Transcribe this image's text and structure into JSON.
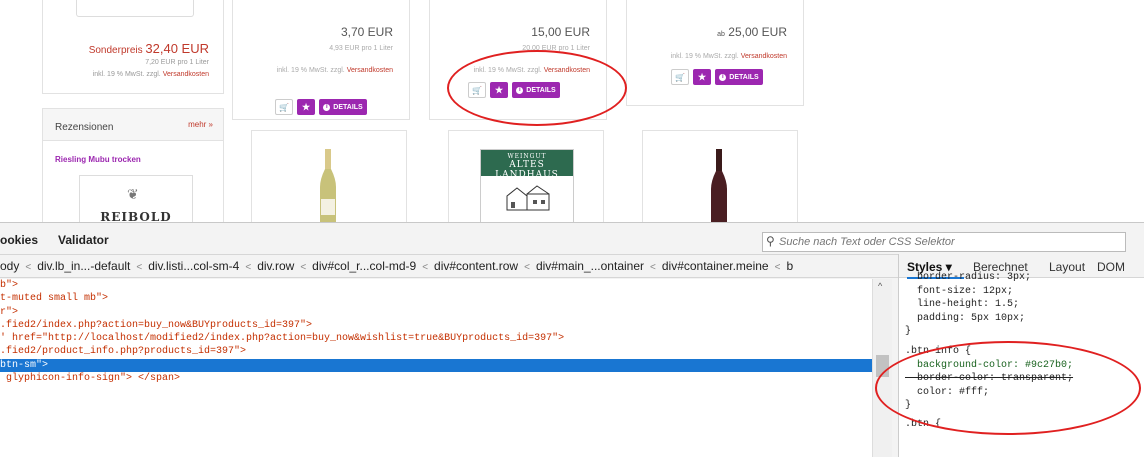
{
  "shop": {
    "left_box": {
      "special_prefix": "Sonderpreis",
      "special_price": "32,40 EUR",
      "per_liter": "7,20 EUR pro 1 Liter",
      "tax_text": "inkl. 19 % MwSt. zzgl.",
      "shipping_link": "Versandkosten"
    },
    "reviews": {
      "title": "Rezensionen",
      "more": "mehr »",
      "wine_link": "Riesling Mubu trocken",
      "logo_text": "REIBOLD"
    },
    "products": [
      {
        "price": "3,70 EUR",
        "prefix": "",
        "per_liter": "4,93 EUR pro 1 Liter",
        "tax": "inkl. 19 % MwSt. zzgl.",
        "shipping": "Versandkosten",
        "details": "DETAILS"
      },
      {
        "price": "15,00 EUR",
        "prefix": "",
        "per_liter": "20,00 EUR pro 1 Liter",
        "tax": "inkl. 19 % MwSt. zzgl.",
        "shipping": "Versandkosten",
        "details": "DETAILS"
      },
      {
        "price": "25,00 EUR",
        "prefix": "ab",
        "per_liter": "",
        "tax": "inkl. 19 % MwSt. zzgl.",
        "shipping": "Versandkosten",
        "details": "DETAILS"
      }
    ],
    "label": {
      "line1": "WEINGUT",
      "line2": "ALTES LANDHAUS"
    },
    "colors": {
      "accent": "#9c27b0",
      "price_red": "#c0392b",
      "annotation": "#e02020"
    }
  },
  "devtools": {
    "tabs": [
      "ookies",
      "Validator"
    ],
    "search_placeholder": "Suche nach Text oder CSS Selektor",
    "breadcrumbs": [
      "ody",
      "div.lb_in...-default",
      "div.listi...col-sm-4",
      "div.row",
      "div#col_r...col-md-9",
      "div#content.row",
      "div#main_...ontainer",
      "div#container.meine",
      "b"
    ],
    "code_lines": [
      {
        "a": "b\">",
        "b": ""
      },
      {
        "a": "t-muted small mb\">",
        "b": ""
      },
      {
        "a": "r\">",
        "b": ""
      },
      {
        "a": ".fied2/index.php?action=buy_now&BUYproducts_id=397\">",
        "b": ""
      },
      {
        "a": "' href=\"http://localhost/modified2/index.php?action=buy_now&wishlist=true&BUYproducts_id=397\">",
        "b": ""
      },
      {
        "a": ".fied2/product_info.php?products_id=397\">",
        "b": ""
      },
      {
        "a": "btn-sm\">",
        "b": ""
      },
      {
        "a": " glyphicon-info-sign\"> </span>",
        "b": ""
      }
    ],
    "styles_tabs": {
      "styles": "Styles",
      "computed": "Berechnet",
      "layout": "Layout",
      "dom": "DOM"
    },
    "css_lines": [
      "  border-radius: 3px;",
      "  font-size: 12px;",
      "  line-height: 1.5;",
      "  padding: 5px 10px;",
      "}",
      ".btn-info {",
      "  background-color: #9c27b0;",
      "  border-color: transparent;",
      "  color: #fff;",
      "}",
      "",
      ".btn {"
    ]
  }
}
